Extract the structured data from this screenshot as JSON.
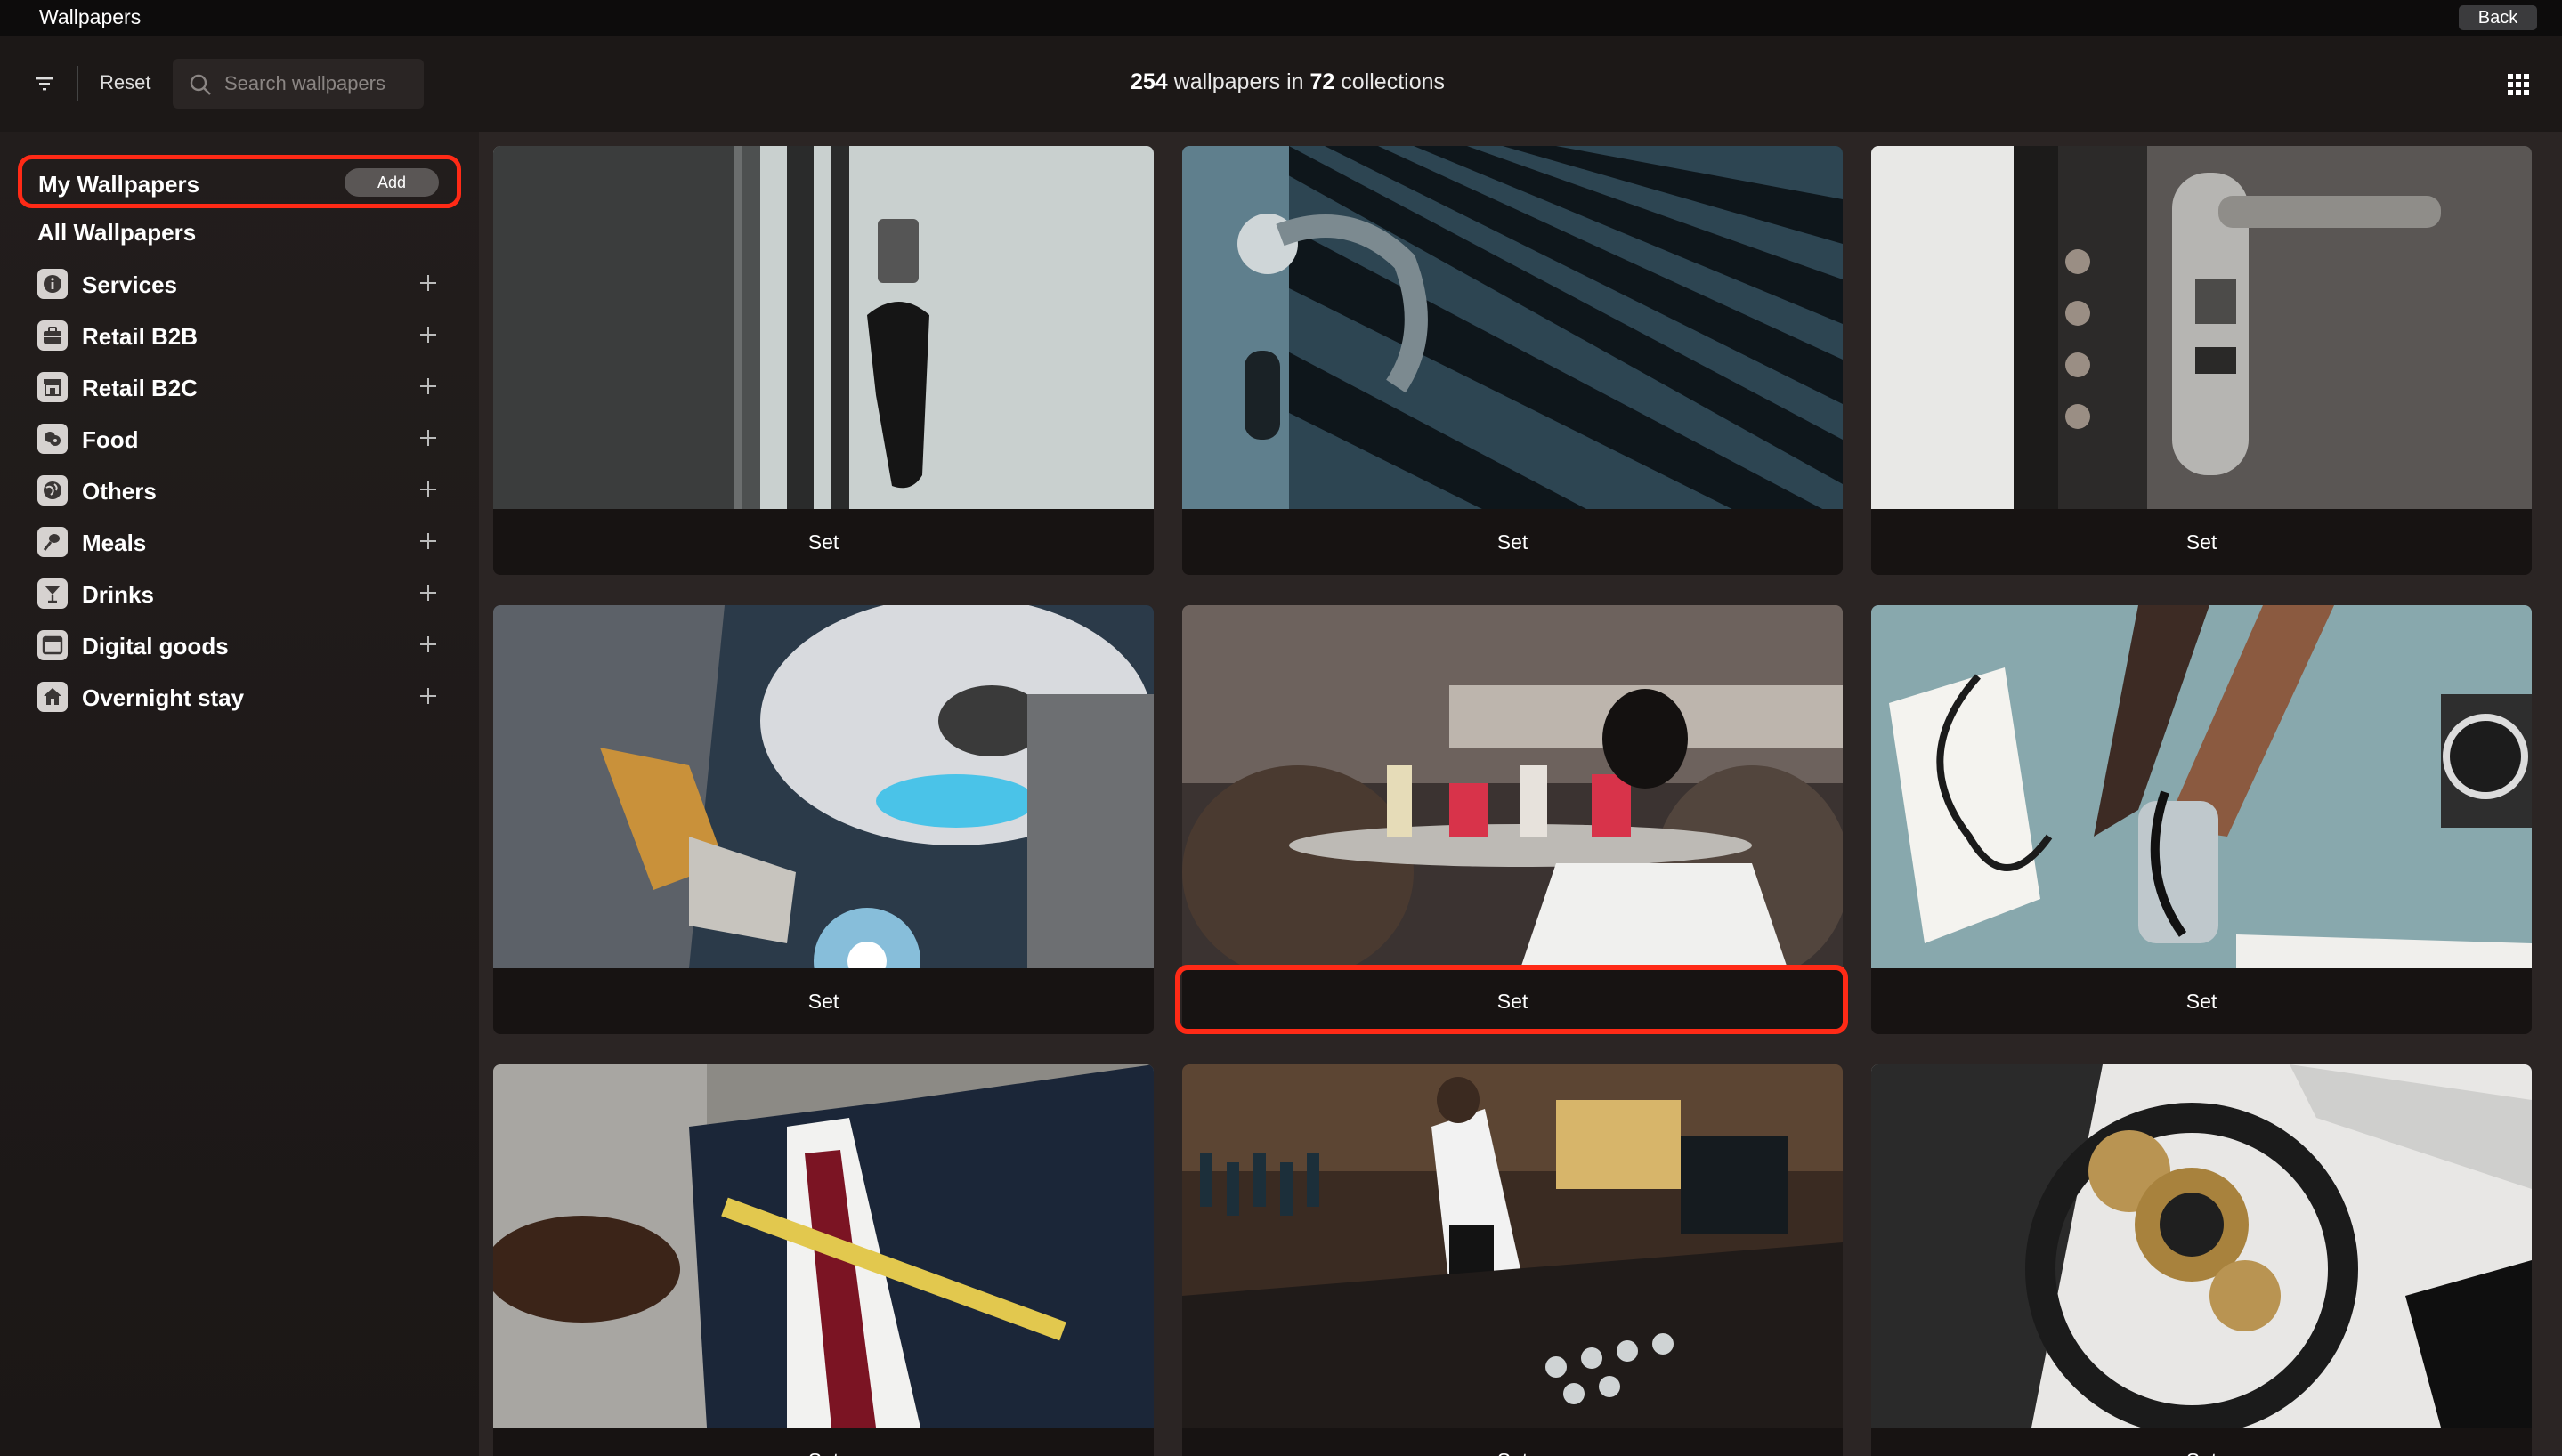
{
  "window": {
    "title": "Wallpapers",
    "back_label": "Back"
  },
  "toolbar": {
    "reset_label": "Reset",
    "search_placeholder": "Search wallpapers",
    "wallpaper_count": "254",
    "wallpapers_in_label": " wallpapers in ",
    "collection_count": "72",
    "collections_label": " collections",
    "filter_icon": "filter-icon",
    "grid_icon": "grid-view-icon"
  },
  "sidebar": {
    "my_wallpapers_label": "My Wallpapers",
    "add_label": "Add",
    "all_wallpapers_label": "All Wallpapers",
    "categories": [
      {
        "label": "Services",
        "icon": "info-icon"
      },
      {
        "label": "Retail B2B",
        "icon": "briefcase-icon"
      },
      {
        "label": "Retail B2C",
        "icon": "storefront-icon"
      },
      {
        "label": "Food",
        "icon": "food-icon"
      },
      {
        "label": "Others",
        "icon": "globe-icon"
      },
      {
        "label": "Meals",
        "icon": "utensils-icon"
      },
      {
        "label": "Drinks",
        "icon": "cocktail-icon"
      },
      {
        "label": "Digital goods",
        "icon": "window-icon"
      },
      {
        "label": "Overnight stay",
        "icon": "house-icon"
      }
    ]
  },
  "wallpapers": [
    {
      "subject": "keys-on-door",
      "set_label": "Set"
    },
    {
      "subject": "door-handle-blue-slats",
      "set_label": "Set"
    },
    {
      "subject": "security-door-lock",
      "set_label": "Set"
    },
    {
      "subject": "welder-at-work",
      "set_label": "Set"
    },
    {
      "subject": "waiter-with-tray",
      "set_label": "Set"
    },
    {
      "subject": "doctor-blood-pressure",
      "set_label": "Set"
    },
    {
      "subject": "tailor-measuring-suit",
      "set_label": "Set"
    },
    {
      "subject": "bartender-at-bar",
      "set_label": "Set"
    },
    {
      "subject": "watch-gears-magnifier",
      "set_label": "Set"
    }
  ],
  "colors": {
    "highlight": "#ff2a16",
    "background": "#2b2524",
    "sidebar": "#1f1b1a"
  }
}
